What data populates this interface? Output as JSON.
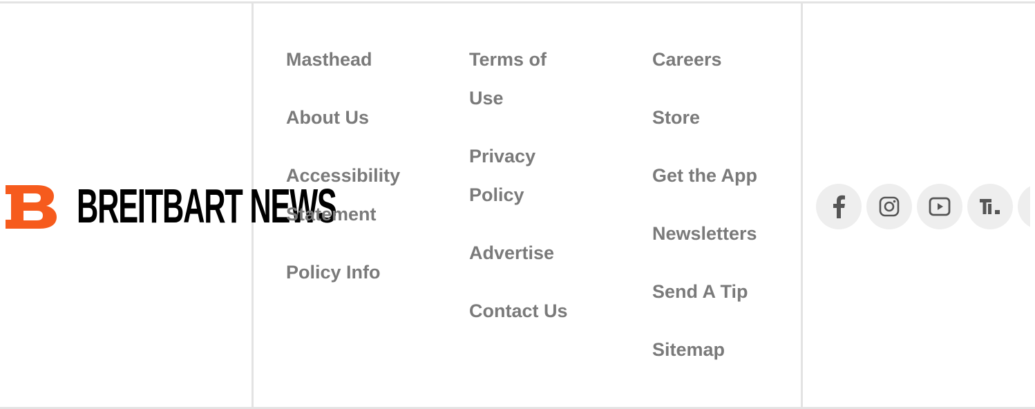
{
  "brand": {
    "wordmark": "BREITBART NEWS",
    "accent_color": "#f65b1d",
    "text_color": "#000000"
  },
  "footer": {
    "column1": [
      "Masthead",
      "About Us",
      "Accessibility Statement",
      "Policy Info"
    ],
    "column2": [
      "Terms of Use",
      "Privacy Policy",
      "Advertise",
      "Contact Us"
    ],
    "column3": [
      "Careers",
      "Store",
      "Get the App",
      "Newsletters",
      "Send A Tip",
      "Sitemap"
    ],
    "link_color": "#7a7a7a"
  },
  "social": {
    "icons": [
      "facebook-icon",
      "instagram-icon",
      "youtube-icon",
      "truth-social-icon",
      "partial-icon"
    ],
    "button_color": "#eeeeee",
    "icon_color": "#555555"
  }
}
